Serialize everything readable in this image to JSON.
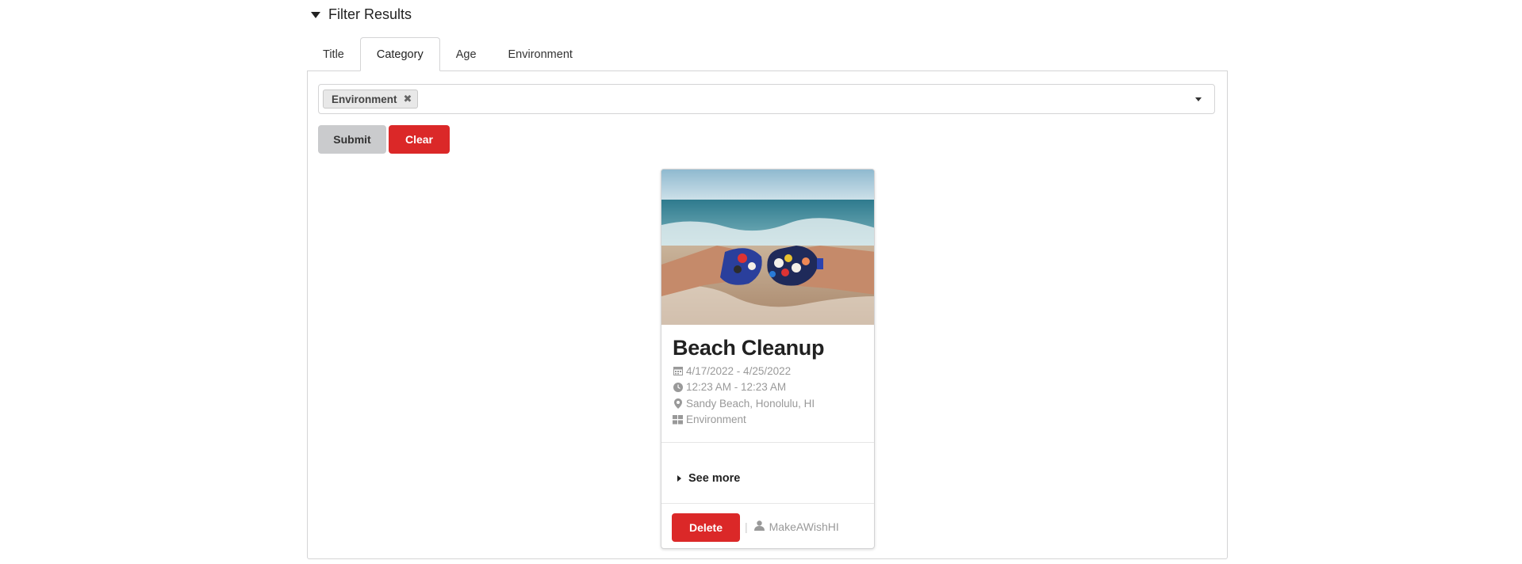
{
  "filter": {
    "header_label": "Filter Results",
    "tabs": [
      {
        "label": "Title"
      },
      {
        "label": "Category"
      },
      {
        "label": "Age"
      },
      {
        "label": "Environment"
      }
    ],
    "active_tab": "Category",
    "selected_chip": "Environment",
    "submit_label": "Submit",
    "clear_label": "Clear"
  },
  "card": {
    "title": "Beach Cleanup",
    "dates": "4/17/2022 - 4/25/2022",
    "times": "12:23 AM - 12:23 AM",
    "location": "Sandy Beach, Honolulu, HI",
    "category": "Environment",
    "see_more_label": "See more",
    "delete_label": "Delete",
    "owner": "MakeAWishHI"
  },
  "colors": {
    "danger": "#db2828",
    "secondary": "#cacbcd",
    "border": "#d4d4d5",
    "muted_text": "#999999"
  },
  "icons": [
    "caret-down-icon",
    "remove-icon",
    "dropdown-icon",
    "calendar-icon",
    "clock-icon",
    "map-marker-icon",
    "grid-icon",
    "caret-right-icon",
    "user-icon"
  ]
}
